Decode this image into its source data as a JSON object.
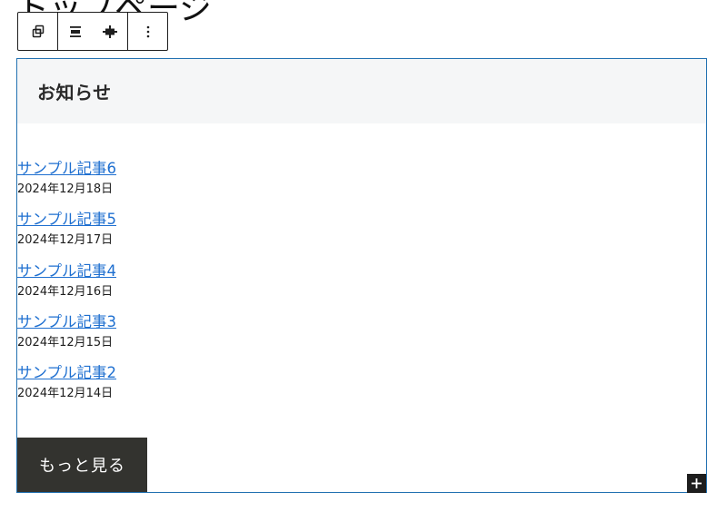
{
  "page": {
    "title": "トップページ"
  },
  "toolbar": {
    "icons": [
      "block-transform-icon",
      "align-icon",
      "justify-icon",
      "more-options-icon"
    ]
  },
  "block": {
    "heading": "お知らせ",
    "posts": [
      {
        "title": "サンプル記事6",
        "date": "2024年12月18日"
      },
      {
        "title": "サンプル記事5",
        "date": "2024年12月17日"
      },
      {
        "title": "サンプル記事4",
        "date": "2024年12月16日"
      },
      {
        "title": "サンプル記事3",
        "date": "2024年12月15日"
      },
      {
        "title": "サンプル記事2",
        "date": "2024年12月14日"
      }
    ],
    "more_label": "もっと見る"
  },
  "colors": {
    "selection_border": "#2271b1",
    "link": "#1e6fd0",
    "header_bg": "#f5f6f7",
    "button_bg": "#33332f"
  }
}
